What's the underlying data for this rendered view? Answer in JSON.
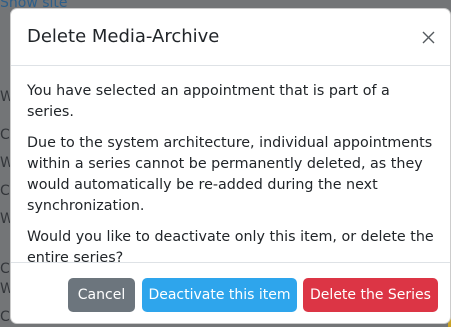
{
  "background": {
    "link_text": "Show site",
    "edge_letters": [
      "W",
      "C",
      "W",
      "C",
      "W",
      "C",
      "W",
      "C"
    ]
  },
  "modal": {
    "title": "Delete Media-Archive",
    "close_icon": "close-icon",
    "paragraphs": [
      "You have selected an appointment that is part of a series.",
      "Due to the system architecture, individual appointments within a series cannot be permanently deleted, as they would automatically be re-added during the next synchronization.",
      "Would you like to deactivate only this item, or delete the entire series?"
    ],
    "buttons": {
      "cancel": "Cancel",
      "deactivate": "Deactivate this item",
      "delete_series": "Delete the Series"
    }
  },
  "colors": {
    "cancel": "#6c757d",
    "deactivate": "#2ea5ec",
    "delete": "#dc3545"
  }
}
